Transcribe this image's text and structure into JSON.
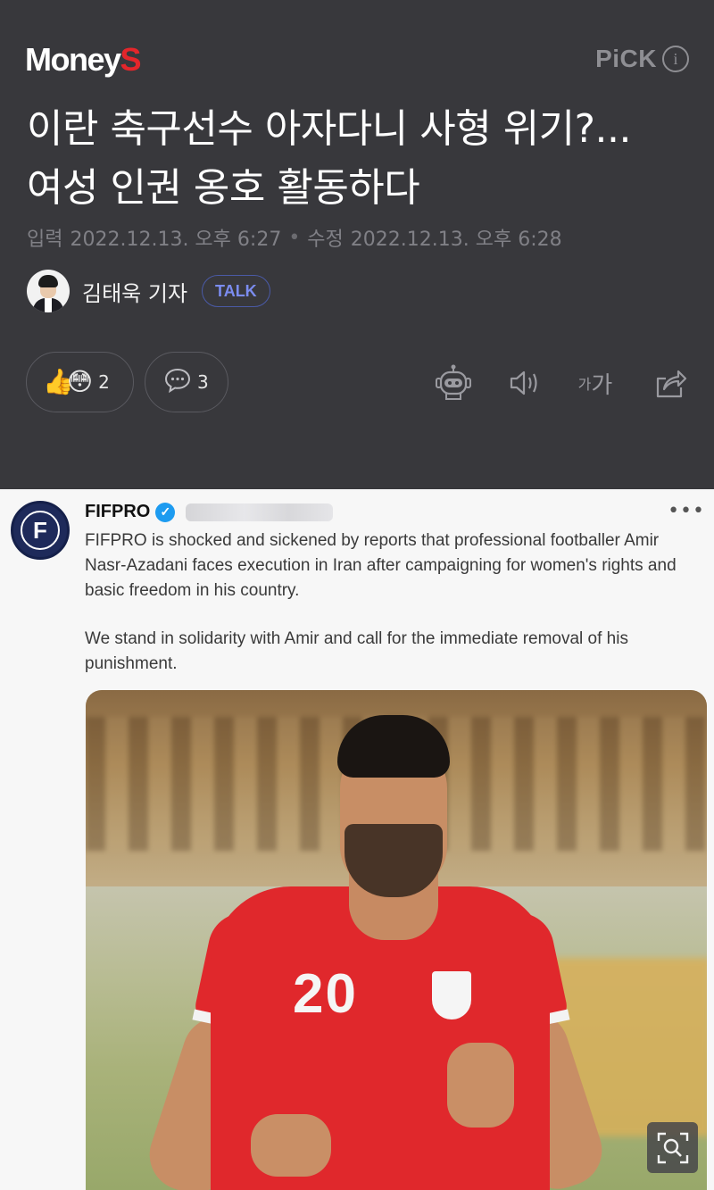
{
  "header": {
    "logo_main": "Money",
    "logo_accent": "S",
    "pick_label": "PiCK",
    "pick_info": "i",
    "title": "이란 축구선수 아자다니 사형 위기?... 여성 인권 옹호 활동하다",
    "input_label": "입력",
    "input_time": "2022.12.13. 오후 6:27",
    "separator": "•",
    "edit_label": "수정",
    "edit_time": "2022.12.13. 오후 6:28",
    "author_name": "김태욱 기자",
    "talk_label": "TALK",
    "reaction_count": "2",
    "comment_count": "3",
    "emoji_1": "👍",
    "emoji_2": "😳",
    "font_small": "가",
    "font_large": "가"
  },
  "tweet": {
    "account": "FIFPRO",
    "verified_mark": "✓",
    "more": "•••",
    "logo_letter": "F",
    "paragraph_1": "FIFPRO is shocked and sickened by reports that professional footballer Amir Nasr-Azadani faces execution in Iran after campaigning for women's rights and basic freedom in his country.",
    "paragraph_2": "We stand in solidarity with Amir and call for the immediate removal of his punishment.",
    "jersey_number": "20"
  },
  "colors": {
    "header_bg": "#38383c",
    "brand_red": "#e4262b",
    "talk_blue": "#7b8cf0",
    "verified_blue": "#1d9bf0",
    "jersey_red": "#e0282c"
  },
  "icons": [
    "info-icon",
    "thumbs-up-emoji",
    "surprised-emoji",
    "comment-icon",
    "robot-summary-icon",
    "speaker-icon",
    "font-size-icon",
    "share-icon",
    "verified-icon",
    "more-icon",
    "zoom-icon"
  ]
}
